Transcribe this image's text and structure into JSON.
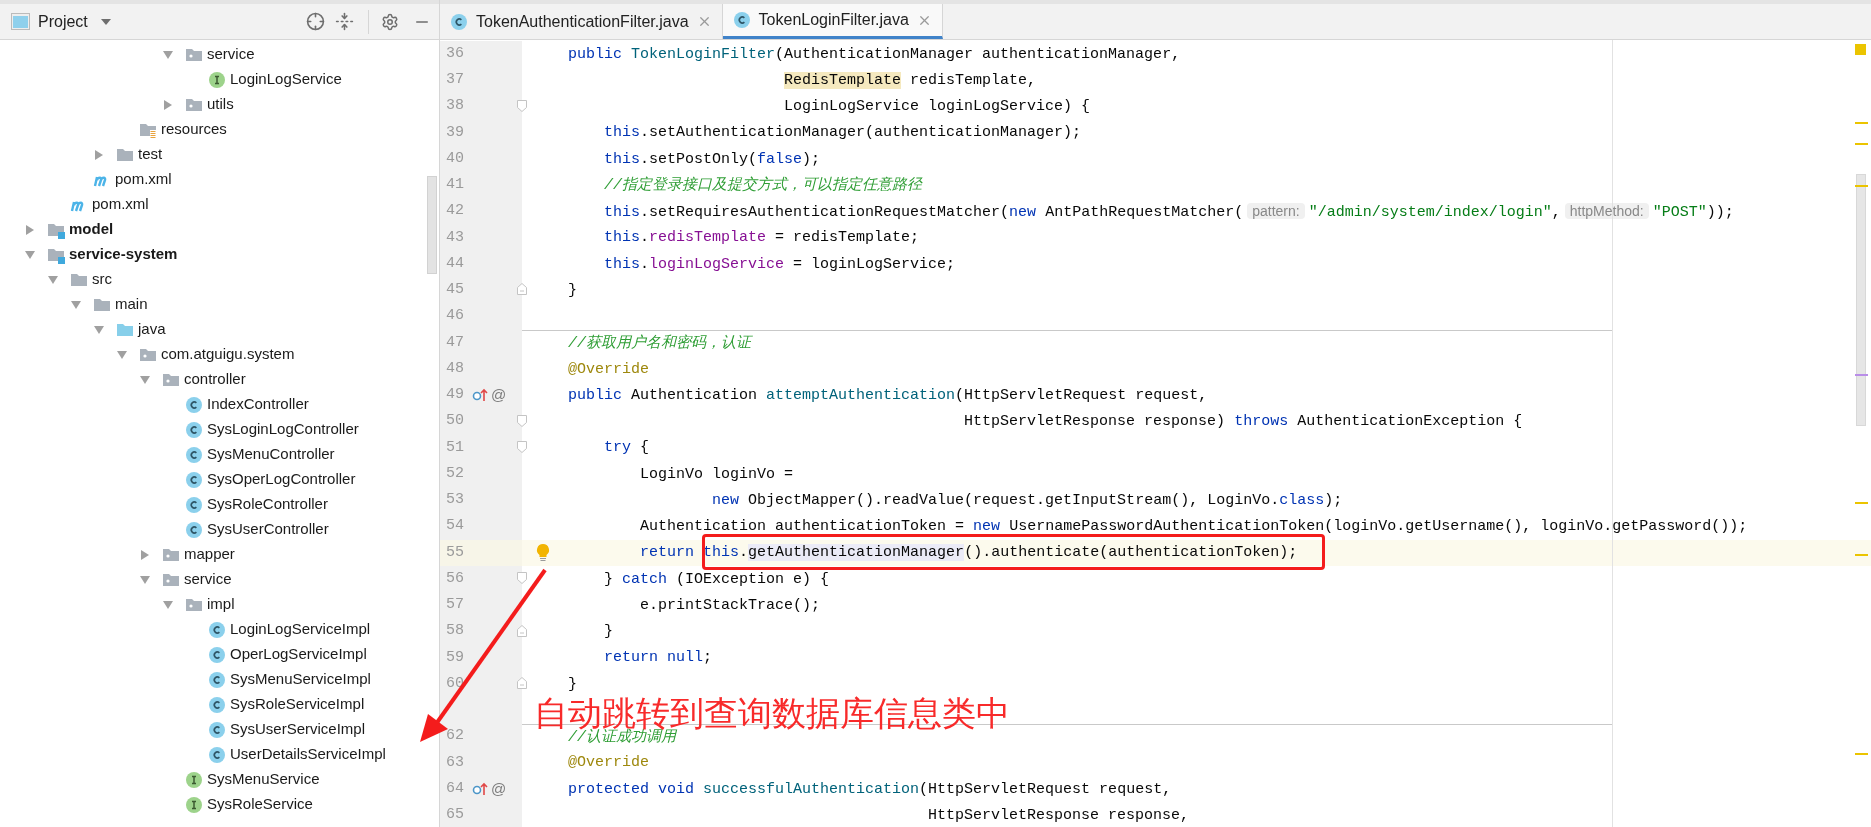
{
  "project_panel": {
    "title": "Project"
  },
  "tree": [
    {
      "children": [
        {
          "children": [
            {
              "children": [
                {
                  "children": [
                    {
                      "children": [
                        {
                          "children": [
                            {
                              "label": "service",
                              "kind": "package",
                              "expanded": true,
                              "children": [
                                {
                                  "label": "LoginLogService",
                                  "kind": "interface"
                                }
                              ]
                            },
                            {
                              "label": "utils",
                              "kind": "package",
                              "expanded": false
                            }
                          ]
                        }
                      ]
                    },
                    {
                      "label": "resources",
                      "kind": "resources"
                    }
                  ]
                },
                {
                  "label": "test",
                  "kind": "folder",
                  "expanded": false
                }
              ]
            },
            {
              "label": "pom.xml",
              "kind": "maven"
            }
          ]
        },
        {
          "label": "pom.xml",
          "kind": "maven"
        }
      ]
    },
    {
      "label": "model",
      "kind": "module",
      "expanded": false
    },
    {
      "label": "service-system",
      "kind": "module",
      "expanded": true,
      "children": [
        {
          "label": "src",
          "kind": "folder",
          "expanded": true,
          "children": [
            {
              "label": "main",
              "kind": "folder",
              "expanded": true,
              "children": [
                {
                  "label": "java",
                  "kind": "source",
                  "expanded": true,
                  "children": [
                    {
                      "label": "com.atguigu.system",
                      "kind": "package",
                      "expanded": true,
                      "children": [
                        {
                          "label": "controller",
                          "kind": "package",
                          "expanded": true,
                          "children": [
                            {
                              "label": "IndexController",
                              "kind": "class"
                            },
                            {
                              "label": "SysLoginLogController",
                              "kind": "class"
                            },
                            {
                              "label": "SysMenuController",
                              "kind": "class"
                            },
                            {
                              "label": "SysOperLogController",
                              "kind": "class"
                            },
                            {
                              "label": "SysRoleController",
                              "kind": "class"
                            },
                            {
                              "label": "SysUserController",
                              "kind": "class"
                            }
                          ]
                        },
                        {
                          "label": "mapper",
                          "kind": "package",
                          "expanded": false
                        },
                        {
                          "label": "service",
                          "kind": "package",
                          "expanded": true,
                          "children": [
                            {
                              "label": "impl",
                              "kind": "package",
                              "expanded": true,
                              "children": [
                                {
                                  "label": "LoginLogServiceImpl",
                                  "kind": "class"
                                },
                                {
                                  "label": "OperLogServiceImpl",
                                  "kind": "class"
                                },
                                {
                                  "label": "SysMenuServiceImpl",
                                  "kind": "class"
                                },
                                {
                                  "label": "SysRoleServiceImpl",
                                  "kind": "class"
                                },
                                {
                                  "label": "SysUserServiceImpl",
                                  "kind": "class"
                                },
                                {
                                  "label": "UserDetailsServiceImpl",
                                  "kind": "class"
                                }
                              ]
                            },
                            {
                              "label": "SysMenuService",
                              "kind": "interface"
                            },
                            {
                              "label": "SysRoleService",
                              "kind": "interface"
                            }
                          ]
                        }
                      ]
                    }
                  ]
                }
              ]
            }
          ]
        }
      ]
    }
  ],
  "tabs": [
    {
      "label": "TokenAuthenticationFilter.java",
      "selected": false
    },
    {
      "label": "TokenLoginFilter.java",
      "selected": true
    }
  ],
  "code_lines": [
    {
      "number": "36",
      "current": false,
      "separator": false,
      "segments": [
        {
          "kind": "keyword",
          "text": "    public "
        },
        {
          "kind": "method",
          "text": "TokenLoginFilter"
        },
        {
          "kind": "plain",
          "text": "(AuthenticationManager authenticationManager,"
        }
      ]
    },
    {
      "number": "37",
      "current": false,
      "separator": false,
      "segments": [
        {
          "kind": "marked",
          "text": "                            RedisTemplate"
        },
        {
          "kind": "plain",
          "text": " redisTemplate,"
        }
      ]
    },
    {
      "number": "38",
      "current": false,
      "separator": false,
      "fold_open": true,
      "segments": [
        {
          "kind": "plain",
          "text": "                            LoginLogService loginLogService) {"
        }
      ]
    },
    {
      "number": "39",
      "current": false,
      "separator": false,
      "segments": [
        {
          "kind": "keyword",
          "text": "        this"
        },
        {
          "kind": "plain",
          "text": ".setAuthenticationManager(authenticationManager);"
        }
      ]
    },
    {
      "number": "40",
      "current": false,
      "separator": false,
      "segments": [
        {
          "kind": "keyword",
          "text": "        this"
        },
        {
          "kind": "plain",
          "text": ".setPostOnly("
        },
        {
          "kind": "keyword",
          "text": "false"
        },
        {
          "kind": "plain",
          "text": ");"
        }
      ]
    },
    {
      "number": "41",
      "current": false,
      "separator": false,
      "segments": [
        {
          "kind": "comment",
          "text": "        //指定登录接口及提交方式，可以指定任意路径"
        }
      ]
    },
    {
      "number": "42",
      "current": false,
      "separator": false,
      "segments": [
        {
          "kind": "keyword",
          "text": "        this"
        },
        {
          "kind": "plain",
          "text": ".setRequiresAuthenticationRequestMatcher("
        },
        {
          "kind": "keyword",
          "text": "new"
        },
        {
          "kind": "plain",
          "text": " AntPathRequestMatcher("
        },
        {
          "kind": "hint",
          "text": "pattern:"
        },
        {
          "kind": "string",
          "text": "\"/admin/system/index/login\""
        },
        {
          "kind": "plain",
          "text": ","
        },
        {
          "kind": "hint",
          "text": "httpMethod:"
        },
        {
          "kind": "string",
          "text": "\"POST\""
        },
        {
          "kind": "plain",
          "text": "));"
        }
      ]
    },
    {
      "number": "43",
      "current": false,
      "separator": false,
      "segments": [
        {
          "kind": "keyword",
          "text": "        this"
        },
        {
          "kind": "plain",
          "text": "."
        },
        {
          "kind": "field",
          "text": "redisTemplate"
        },
        {
          "kind": "plain",
          "text": " = redisTemplate;"
        }
      ]
    },
    {
      "number": "44",
      "current": false,
      "separator": false,
      "segments": [
        {
          "kind": "keyword",
          "text": "        this"
        },
        {
          "kind": "plain",
          "text": "."
        },
        {
          "kind": "field",
          "text": "loginLogService"
        },
        {
          "kind": "plain",
          "text": " = loginLogService;"
        }
      ]
    },
    {
      "number": "45",
      "current": false,
      "separator": false,
      "fold_close": true,
      "segments": [
        {
          "kind": "plain",
          "text": "    }"
        }
      ]
    },
    {
      "number": "46",
      "current": false,
      "separator": false
    },
    {
      "number": "47",
      "current": false,
      "separator": true,
      "segments": [
        {
          "kind": "comment",
          "text": "    //获取用户名和密码，认证"
        }
      ]
    },
    {
      "number": "48",
      "current": false,
      "separator": false,
      "segments": [
        {
          "kind": "annotation",
          "text": "    @Override"
        }
      ]
    },
    {
      "number": "49",
      "current": false,
      "separator": false,
      "override": true,
      "gutter_text": "@",
      "segments": [
        {
          "kind": "keyword",
          "text": "    public"
        },
        {
          "kind": "plain",
          "text": " Authentication "
        },
        {
          "kind": "method",
          "text": "attemptAuthentication"
        },
        {
          "kind": "plain",
          "text": "(HttpServletRequest request,"
        }
      ]
    },
    {
      "number": "50",
      "current": false,
      "separator": false,
      "fold_open": true,
      "segments": [
        {
          "kind": "plain",
          "text": "                                                HttpServletResponse response) "
        },
        {
          "kind": "keyword",
          "text": "throws"
        },
        {
          "kind": "plain",
          "text": " AuthenticationException {"
        }
      ]
    },
    {
      "number": "51",
      "current": false,
      "separator": false,
      "fold_open": true,
      "segments": [
        {
          "kind": "keyword",
          "text": "        try"
        },
        {
          "kind": "plain",
          "text": " {"
        }
      ]
    },
    {
      "number": "52",
      "current": false,
      "separator": false,
      "segments": [
        {
          "kind": "plain",
          "text": "            LoginVo loginVo ="
        }
      ]
    },
    {
      "number": "53",
      "current": false,
      "separator": false,
      "segments": [
        {
          "kind": "keyword",
          "text": "                    new"
        },
        {
          "kind": "plain",
          "text": " ObjectMapper().readValue(request.getInputStream(), LoginVo."
        },
        {
          "kind": "keyword",
          "text": "class"
        },
        {
          "kind": "plain",
          "text": ");"
        }
      ]
    },
    {
      "number": "54",
      "current": false,
      "separator": false,
      "segments": [
        {
          "kind": "plain",
          "text": "            Authentication authenticationToken = "
        },
        {
          "kind": "keyword",
          "text": "new"
        },
        {
          "kind": "plain",
          "text": " UsernamePasswordAuthenticationToken(loginVo.getUsername(), loginVo.getPassword());"
        }
      ]
    },
    {
      "number": "55",
      "current": true,
      "separator": false,
      "bulb": true,
      "segments": [
        {
          "kind": "keyword",
          "text": "            return this"
        },
        {
          "kind": "plain",
          "text": "."
        },
        {
          "kind": "usage",
          "text": "getAuthenticationManager"
        },
        {
          "kind": "plain",
          "text": "().authenticate(authenticationToken);"
        }
      ]
    },
    {
      "number": "56",
      "current": false,
      "separator": false,
      "fold_open": true,
      "segments": [
        {
          "kind": "plain",
          "text": "        } "
        },
        {
          "kind": "keyword",
          "text": "catch"
        },
        {
          "kind": "plain",
          "text": " (IOException e) {"
        }
      ]
    },
    {
      "number": "57",
      "current": false,
      "separator": false,
      "segments": [
        {
          "kind": "plain",
          "text": "            e.printStackTrace();"
        }
      ]
    },
    {
      "number": "58",
      "current": false,
      "separator": false,
      "fold_close": true,
      "segments": [
        {
          "kind": "plain",
          "text": "        }"
        }
      ]
    },
    {
      "number": "59",
      "current": false,
      "separator": false,
      "segments": [
        {
          "kind": "keyword",
          "text": "        return null"
        },
        {
          "kind": "plain",
          "text": ";"
        }
      ]
    },
    {
      "number": "60",
      "current": false,
      "separator": false,
      "fold_close": true,
      "segments": [
        {
          "kind": "plain",
          "text": "    }"
        }
      ]
    },
    {
      "current": false,
      "separator": false
    },
    {
      "number": "62",
      "current": false,
      "separator": true,
      "segments": [
        {
          "kind": "comment",
          "text": "    //认证成功调用"
        }
      ]
    },
    {
      "number": "63",
      "current": false,
      "separator": false,
      "segments": [
        {
          "kind": "annotation",
          "text": "    @Override"
        }
      ]
    },
    {
      "number": "64",
      "current": false,
      "separator": false,
      "override": true,
      "gutter_text": "@",
      "segments": [
        {
          "kind": "keyword",
          "text": "    protected void "
        },
        {
          "kind": "method",
          "text": "successfulAuthentication"
        },
        {
          "kind": "plain",
          "text": "(HttpServletRequest request,"
        }
      ]
    },
    {
      "number": "65",
      "current": false,
      "separator": false,
      "segments": [
        {
          "kind": "plain",
          "text": "                                            HttpServletResponse response,"
        }
      ]
    }
  ],
  "annotation": {
    "text": "自动跳转到查询数据库信息类中"
  }
}
